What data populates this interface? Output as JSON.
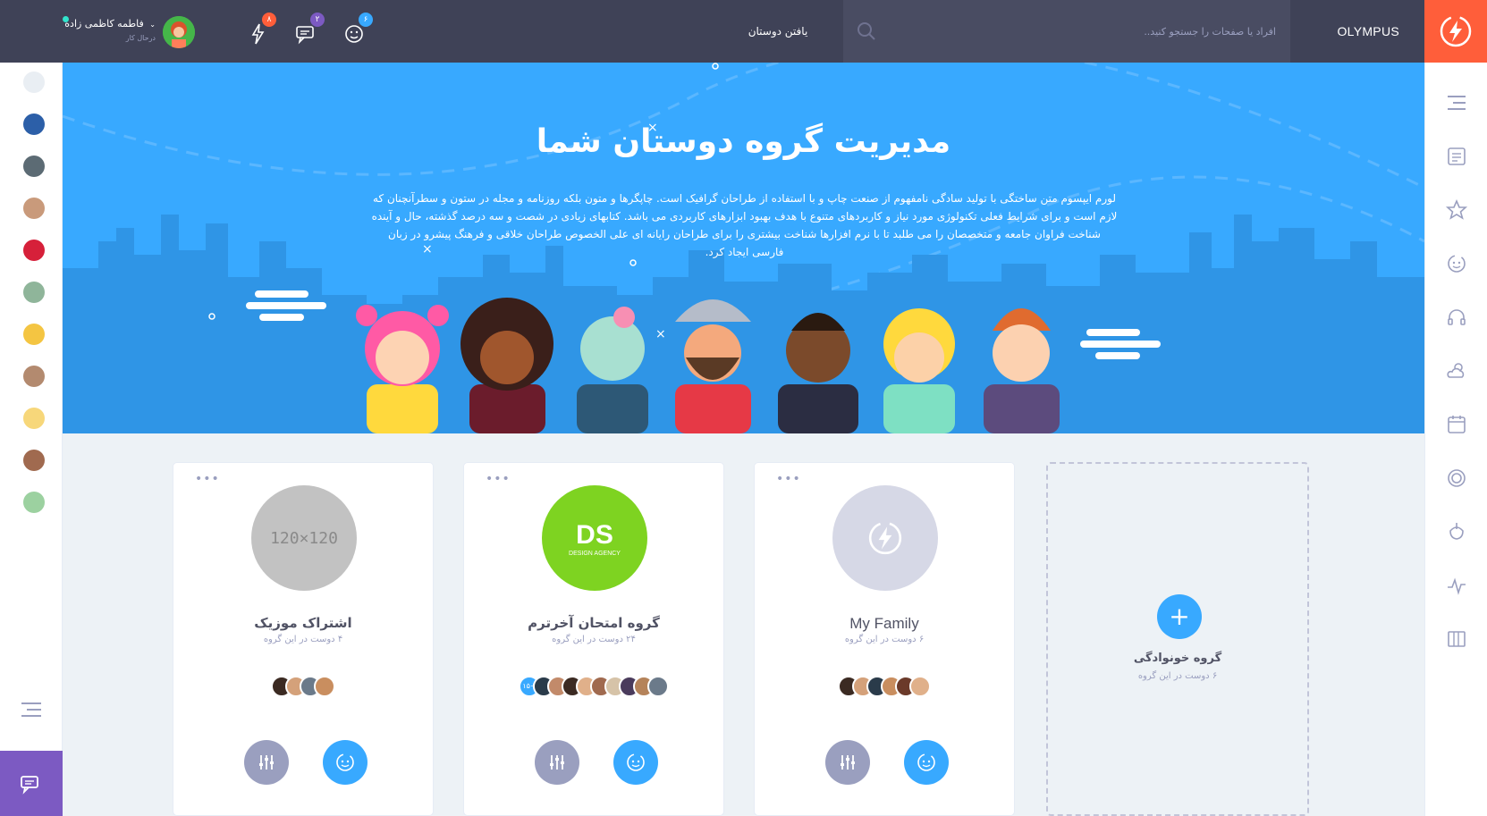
{
  "header": {
    "brand": "OLYMPUS",
    "search_placeholder": "افراد یا صفحات را جستجو کنید..",
    "find_friends": "یافتن دوستان",
    "notifications": [
      {
        "icon": "smiley-icon",
        "count": "۶",
        "color": "#38a9ff"
      },
      {
        "icon": "chat-icon",
        "count": "۲",
        "color": "#7c5ac2"
      },
      {
        "icon": "flash-icon",
        "count": "۸",
        "color": "#ff5e3a"
      }
    ],
    "user": {
      "name": "فاطمه کاظمی زاده",
      "status": "درحال کار"
    }
  },
  "hero": {
    "title": "مدیریت گروه دوستان شما",
    "description": "لورم ایپسوم متن ساختگی با تولید سادگی نامفهوم از صنعت چاپ و با استفاده از طراحان گرافیک است. چاپگرها و متون بلکه روزنامه و مجله در ستون و سطرآنچنان که لازم است و برای شرایط فعلی تکنولوژی مورد نیاز و کاربردهای متنوع با هدف بهبود ابزارهای کاربردی می باشد. کتابهای زیادی در شصت و سه درصد گذشته، حال و آینده شناخت فراوان جامعه و متخصصان را می طلبد تا با نرم افزارها شناخت بیشتری را برای طراحان رایانه ای علی الخصوص طراحان خلاقی و فرهنگ پیشرو در زبان فارسی ایجاد کرد."
  },
  "groups": [
    {
      "name": "اشتراک موزیک",
      "count": "۴ دوست در این گروه",
      "image_text": "120×120",
      "image_color": "#c2c2c2"
    },
    {
      "name": "گروه امتحان آخرترم",
      "count": "۲۴ دوست در این گروه",
      "image_text": "DS",
      "image_sub": "DESIGN AGENCY",
      "image_color": "#7ed321",
      "more_badge": "۱۵+"
    },
    {
      "name": "My Family",
      "count": "۶ دوست در این گروه",
      "image_color": "#d6d8e6"
    }
  ],
  "add_group": {
    "plus": "+",
    "name": "گروه خونوادگی",
    "count": "۶ دوست در این گروه"
  },
  "colors": {
    "primary": "#38a9ff",
    "accent": "#ff5e3a",
    "purple": "#7c5ac2",
    "topbar": "#3f4257"
  }
}
